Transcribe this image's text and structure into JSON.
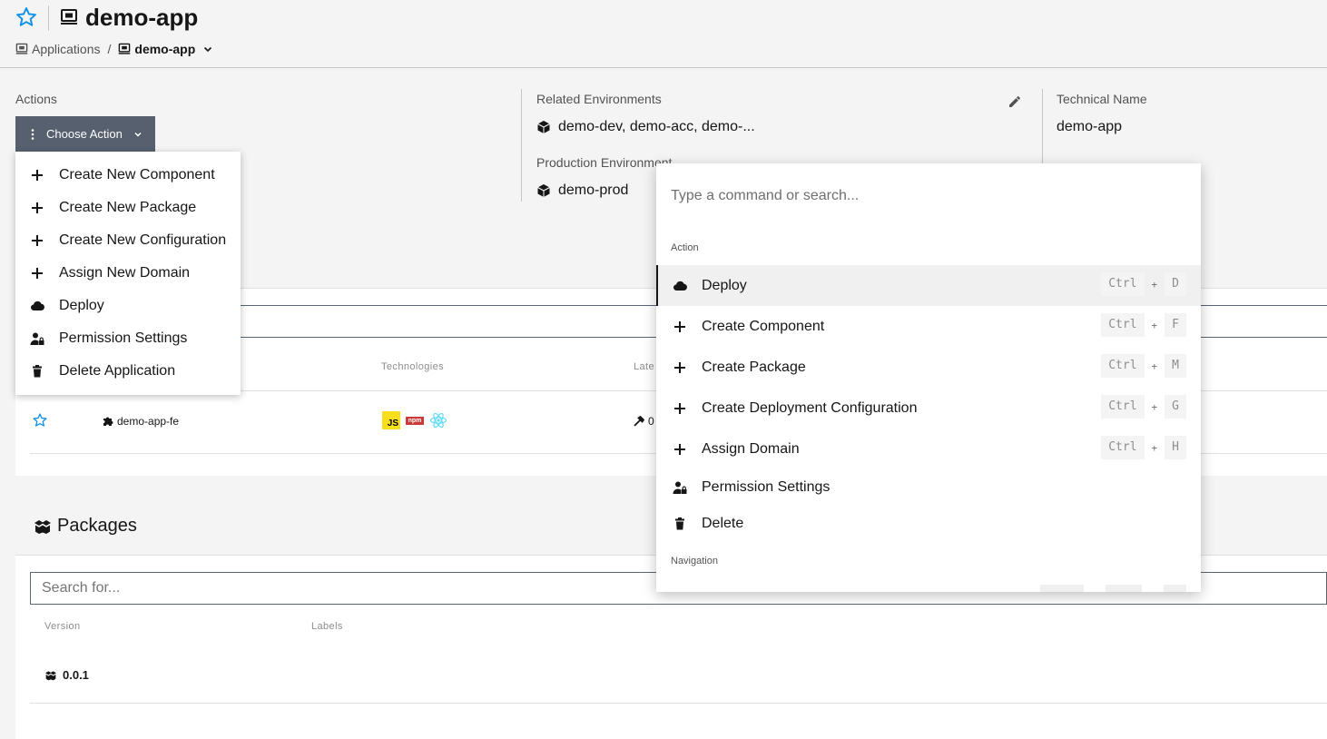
{
  "header": {
    "title": "demo-app",
    "breadcrumb": {
      "parent": "Applications",
      "separator": "/",
      "current": "demo-app"
    }
  },
  "summary": {
    "actions_label": "Actions",
    "choose_action": "Choose Action",
    "related_env_label": "Related Environments",
    "related_env_value": "demo-dev, demo-acc, demo-...",
    "prod_env_label": "Production Environment",
    "prod_env_value": "demo-prod",
    "tech_name_label": "Technical Name",
    "tech_name_value": "demo-app"
  },
  "actions_menu": {
    "items": [
      {
        "label": "Create New Component",
        "icon": "plus-icon"
      },
      {
        "label": "Create New Package",
        "icon": "plus-icon"
      },
      {
        "label": "Create New Configuration",
        "icon": "plus-icon"
      },
      {
        "label": "Assign New Domain",
        "icon": "plus-icon"
      },
      {
        "label": "Deploy",
        "icon": "cloud-icon"
      },
      {
        "label": "Permission Settings",
        "icon": "user-lock-icon"
      },
      {
        "label": "Delete Application",
        "icon": "trash-icon"
      }
    ]
  },
  "components": {
    "columns": {
      "technologies": "Technologies",
      "latest": "Late"
    },
    "rows": [
      {
        "name": "demo-app-fe",
        "technologies": [
          "JS",
          "npm",
          "react"
        ],
        "latest": "0"
      }
    ]
  },
  "packages": {
    "title": "Packages",
    "search_placeholder": "Search for...",
    "columns": {
      "version": "Version",
      "labels": "Labels"
    },
    "rows": [
      {
        "version": "0.0.1"
      }
    ]
  },
  "command_palette": {
    "placeholder": "Type a command or search...",
    "groups": {
      "action": "Action",
      "navigation": "Navigation"
    },
    "items": [
      {
        "label": "Deploy",
        "icon": "cloud-icon",
        "mod": "Ctrl",
        "key": "D",
        "active": true
      },
      {
        "label": "Create Component",
        "icon": "plus-icon",
        "mod": "Ctrl",
        "key": "F"
      },
      {
        "label": "Create Package",
        "icon": "plus-icon",
        "mod": "Ctrl",
        "key": "M"
      },
      {
        "label": "Create Deployment Configuration",
        "icon": "plus-icon",
        "mod": "Ctrl",
        "key": "G"
      },
      {
        "label": "Assign Domain",
        "icon": "plus-icon",
        "mod": "Ctrl",
        "key": "H"
      },
      {
        "label": "Permission Settings",
        "icon": "user-lock-icon"
      },
      {
        "label": "Delete",
        "icon": "trash-icon"
      }
    ],
    "plus_sign": "+"
  },
  "colors": {
    "accent_star": "#1192e8",
    "button_bg": "#56606f",
    "js_yellow": "#f7df1e",
    "npm_red": "#cb3837",
    "react_cyan": "#61dafb"
  }
}
